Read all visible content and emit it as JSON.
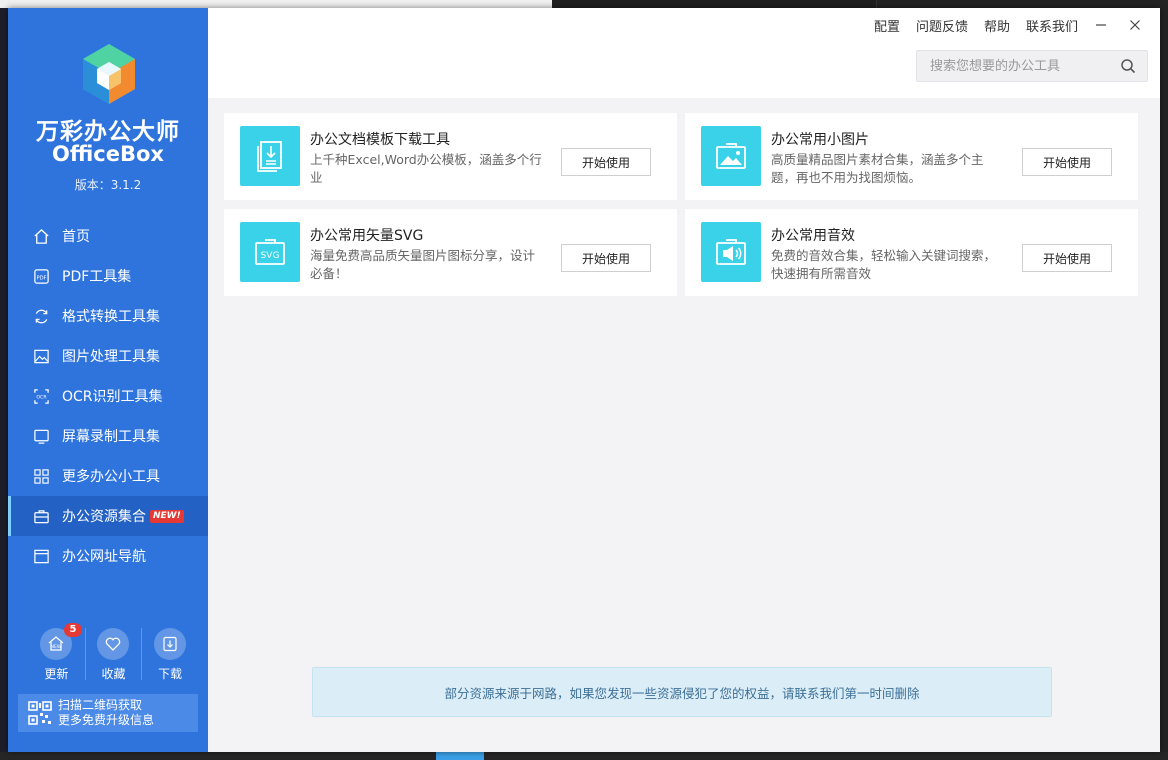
{
  "app": {
    "name_cn": "万彩办公大师",
    "name_en": "OfficeBox",
    "version": "版本：3.1.2"
  },
  "top_menu": {
    "items": [
      "配置",
      "问题反馈",
      "帮助",
      "联系我们"
    ]
  },
  "search": {
    "placeholder": "搜索您想要的办公工具"
  },
  "sidebar": {
    "items": [
      {
        "label": "首页",
        "icon": "home-icon"
      },
      {
        "label": "PDF工具集",
        "icon": "pdf-icon"
      },
      {
        "label": "格式转换工具集",
        "icon": "convert-icon"
      },
      {
        "label": "图片处理工具集",
        "icon": "image-icon"
      },
      {
        "label": "OCR识别工具集",
        "icon": "ocr-icon"
      },
      {
        "label": "屏幕录制工具集",
        "icon": "screen-icon"
      },
      {
        "label": "更多办公小工具",
        "icon": "grid-icon"
      },
      {
        "label": "办公资源集合",
        "icon": "briefcase-icon",
        "badge": "NEW!",
        "active": true
      },
      {
        "label": "办公网址导航",
        "icon": "browser-icon"
      }
    ],
    "actions": [
      {
        "label": "更新",
        "icon": "new-icon",
        "count": "5"
      },
      {
        "label": "收藏",
        "icon": "heart-icon"
      },
      {
        "label": "下载",
        "icon": "download-icon"
      }
    ],
    "qr": {
      "line1": "扫描二维码获取",
      "line2": "更多免费升级信息"
    }
  },
  "cards": [
    {
      "title": "办公文档模板下载工具",
      "desc": "上千种Excel,Word办公模板，涵盖多个行业",
      "button": "开始使用",
      "icon": "document-download-icon"
    },
    {
      "title": "办公常用小图片",
      "desc": "高质量精品图片素材合集，涵盖多个主题，再也不用为找图烦恼。",
      "button": "开始使用",
      "icon": "picture-icon"
    },
    {
      "title": "办公常用矢量SVG",
      "desc": "海量免费高品质矢量图片图标分享，设计必备！",
      "button": "开始使用",
      "icon": "svg-icon"
    },
    {
      "title": "办公常用音效",
      "desc": "免费的音效合集，轻松输入关键词搜索，快速拥有所需音效",
      "button": "开始使用",
      "icon": "speaker-icon"
    }
  ],
  "notice": "部分资源来源于网路，如果您发现一些资源侵犯了您的权益，请联系我们第一时间删除",
  "colors": {
    "sidebar": "#2f74dd",
    "sidebar_active": "#2461c4",
    "card_icon": "#39d2e8",
    "badge": "#e53935"
  }
}
